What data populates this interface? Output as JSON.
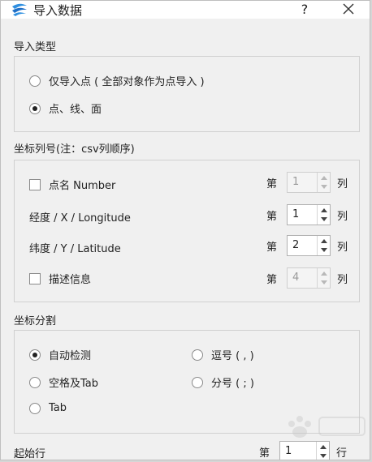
{
  "window": {
    "title": "导入数据",
    "help_label": "?"
  },
  "import_type": {
    "heading": "导入类型",
    "options": [
      {
        "label": "仅导入点 ( 全部对象作为点导入 )",
        "checked": false
      },
      {
        "label": "点、线、面",
        "checked": true
      }
    ]
  },
  "columns": {
    "heading": "坐标列号(注：csv列顺序)",
    "prefix": "第",
    "suffix": "列",
    "rows": [
      {
        "label": "点名 Number",
        "has_checkbox": true,
        "value": "1",
        "enabled": false
      },
      {
        "label": "经度 / X / Longitude",
        "has_checkbox": false,
        "value": "1",
        "enabled": true
      },
      {
        "label": "纬度 / Y / Latitude",
        "has_checkbox": false,
        "value": "2",
        "enabled": true
      },
      {
        "label": "描述信息",
        "has_checkbox": true,
        "value": "4",
        "enabled": false
      }
    ]
  },
  "separator": {
    "heading": "坐标分割",
    "options": [
      {
        "label": "自动检测",
        "checked": true
      },
      {
        "label": "逗号 ( , )",
        "checked": false
      },
      {
        "label": "空格及Tab",
        "checked": false
      },
      {
        "label": "分号 ( ; )",
        "checked": false
      },
      {
        "label": "Tab",
        "checked": false
      }
    ]
  },
  "start_row": {
    "label": "起始行",
    "prefix": "第",
    "value": "1",
    "suffix": "行"
  }
}
